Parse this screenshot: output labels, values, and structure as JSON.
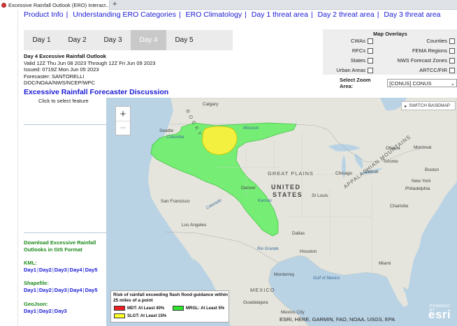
{
  "browser": {
    "tab_title": "Excessive Rainfall Outlook (ERO) Interact...",
    "close_glyph": "×",
    "new_tab_glyph": "+"
  },
  "nav": [
    "Product Info",
    "Understanding ERO Categories",
    "ERO Climatology",
    "Day 1 threat area",
    "Day 2 threat area",
    "Day 3 threat area"
  ],
  "day_tabs": [
    "Day 1",
    "Day 2",
    "Day 3",
    "Day 4",
    "Day 5"
  ],
  "selected_day_index": 3,
  "outlook": {
    "title": "Day 4 Excessive Rainfall Outlook",
    "valid": "Valid 12Z Thu Jun 08 2023 Through 12Z Fri Jun 09 2023",
    "issued": "Issued: 0719Z Mon Jun 05 2023",
    "forecaster": "Forecaster: SANTORELLI",
    "agency": "DOC/NOAA/NWS/NCEP/WPC"
  },
  "discussion_link": "Excessive Rainfall Forecaster Discussion",
  "click_to_select": "Click to select feature",
  "gis": {
    "heading": "Download Excessive Rainfall Outlooks in GIS Format",
    "kml_label": "KML:",
    "shapefile_label": "Shapefile:",
    "geojson_label": "GeoJson:",
    "kml_days": [
      "Day1",
      "Day2",
      "Day3",
      "Day4",
      "Day5"
    ],
    "shapefile_days": [
      "Day1",
      "Day2",
      "Day3",
      "Day4",
      "Day5"
    ],
    "geojson_days": [
      "Day1",
      "Day2",
      "Day3"
    ],
    "separator": "|"
  },
  "overlays": {
    "title": "Map Overlays",
    "left": [
      "CWAs",
      "RFCs",
      "States",
      "Urban Areas"
    ],
    "right": [
      "Counties",
      "FEMA Regions",
      "NWS Forecast Zones",
      "ARTCC/FIR"
    ]
  },
  "zoom": {
    "label": "Select Zoom Area:",
    "value": "[CONUS] CONUS"
  },
  "map": {
    "zoom_in": "+",
    "zoom_out": "−",
    "switch_basemap": "SWITCH BASEMAP",
    "attribution": "ESRI, HERE, GARMIN, FAO, NOAA, USGS, EPA",
    "esri_logo": "esri",
    "esri_powered": "POWERED BY",
    "labels": {
      "calgary": "Calgary",
      "seattle": "Seattle",
      "missouri": "Missouri",
      "ottawa": "Ottawa",
      "montreal": "Montreal",
      "toronto": "Toronto",
      "boston": "Boston",
      "new_york": "New York",
      "philadelphia": "Philadelphia",
      "chicago": "Chicago",
      "detroit": "Detroit",
      "great_plains": "GREAT PLAINS",
      "united_states": "UNITED",
      "united_states2": "STATES",
      "denver": "Denver",
      "kansas": "Kansas",
      "st_louis": "St Louis",
      "charlotte": "Charlotte",
      "san_francisco": "San Francisco",
      "los_angeles": "Los Angeles",
      "dallas": "Dallas",
      "houston": "Houston",
      "monterrey": "Monterrey",
      "mexico": "MEXICO",
      "guadalajara": "Guadalajara",
      "mexico_city": "Mexico City",
      "miami": "Miami",
      "rio_grande": "Rio Grande",
      "appalachian": "APPALACHIAN MOUNTAINS",
      "rocky": "R O C K Y",
      "gulf": "Gulf of Mexico",
      "colorado": "Colorado",
      "columbia": "Columbia"
    }
  },
  "legend": {
    "title": "Risk of rainfall exceeding flash flood guidance within 25 miles of a point",
    "items": [
      {
        "label": "MDT: At Least 40%",
        "color": "#f01e1e"
      },
      {
        "label": "MRGL: At Least 5%",
        "color": "#2ee82e"
      },
      {
        "label": "SLGT: At Least 15%",
        "color": "#ffff2a"
      }
    ]
  },
  "colors": {
    "link": "#1a1ad6",
    "green_text": "#1a8a1a",
    "mrgl": "#66f266",
    "slgt": "#f4f040",
    "water": "#b9d3e5",
    "land": "#e4e4dc"
  }
}
